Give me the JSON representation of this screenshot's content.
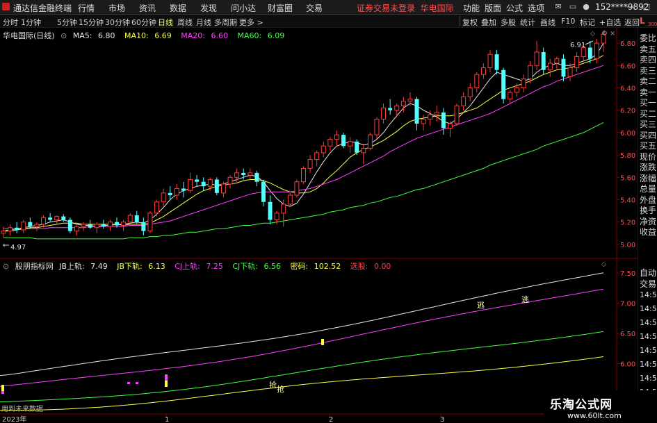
{
  "menubar": {
    "app_title": "通达信金融终端",
    "menus": [
      "行情",
      "市场",
      "资讯",
      "数据",
      "发现",
      "问小达",
      "财富圈",
      "交易"
    ],
    "notice": "证券交易未登录",
    "broker": "华电国际",
    "right_menus": [
      "功能",
      "版面",
      "公式",
      "选项"
    ],
    "account": "152****9892"
  },
  "toolbar": {
    "periods": [
      "分时",
      "1分钟",
      "5分钟",
      "15分钟",
      "30分钟",
      "60分钟",
      "日线",
      "周线",
      "月线",
      "多周期",
      "更多"
    ],
    "active_period": "日线",
    "more_arrow": ">",
    "right_tools": [
      "复权",
      "叠加",
      "多股",
      "统计",
      "画线",
      "F10",
      "标记",
      "+自选",
      "返回"
    ]
  },
  "main_chart": {
    "title": "华电国际(日线)",
    "ma": [
      {
        "label": "MA5:",
        "value": "6.80",
        "color": "#e8e8e8"
      },
      {
        "label": "MA10:",
        "value": "6.69",
        "color": "#ffff40"
      },
      {
        "label": "MA20:",
        "value": "6.60",
        "color": "#ff40ff"
      },
      {
        "label": "MA60:",
        "value": "6.09",
        "color": "#40ff40"
      }
    ],
    "y_ticks": [
      "6.80",
      "6.60",
      "6.40",
      "6.20",
      "6.00",
      "5.80",
      "5.60",
      "5.40",
      "5.20",
      "5.00"
    ],
    "low_marker": "4.97",
    "high_marker": "6.91"
  },
  "indicator": {
    "title": "股朋指标网",
    "items": [
      {
        "label": "JB上轨:",
        "value": "7.49",
        "color": "#e8e8e8"
      },
      {
        "label": "JB下轨:",
        "value": "6.13",
        "color": "#ffff40"
      },
      {
        "label": "CJ上轨:",
        "value": "7.25",
        "color": "#ff40ff"
      },
      {
        "label": "CJ下轨:",
        "value": "6.56",
        "color": "#40ff40"
      },
      {
        "label": "密码:",
        "value": "102.52",
        "color": "#ffff40"
      },
      {
        "label": "选股:",
        "value": "0.00",
        "color": "#ff4040"
      }
    ],
    "y_ticks": [
      "7.50",
      "7.00",
      "6.50",
      "6.00",
      "5.50"
    ],
    "signal_escape": "逃",
    "signal_buy": "抢",
    "footer_note": "用到未来数据"
  },
  "x_axis": {
    "labels": [
      "2023年",
      "1",
      "2",
      "3"
    ]
  },
  "side_panel": {
    "corner_label": "L",
    "corner_sub": "300",
    "quote_labels": [
      "委比",
      "卖五",
      "卖四",
      "卖三",
      "卖二",
      "卖一",
      "买一",
      "买二",
      "买三",
      "买四",
      "买五",
      "现价",
      "涨跌",
      "涨幅",
      "总量",
      "外盘",
      "换手",
      "净资",
      "收益"
    ],
    "lower_labels": [
      "自动",
      "交易"
    ],
    "times": [
      "14:56",
      "14:56",
      "14:56",
      "14:56",
      "14:56",
      "14:56",
      "14:56",
      "14:56"
    ]
  },
  "watermark": {
    "name": "乐淘公式网",
    "url": "www.60lt.com"
  },
  "chart_data": [
    {
      "type": "candlestick",
      "title": "华电国际(日线)",
      "y_range": [
        4.9,
        6.9
      ],
      "ohlc": [
        [
          5.1,
          5.16,
          5.06,
          5.12
        ],
        [
          5.12,
          5.18,
          5.08,
          5.15
        ],
        [
          5.15,
          5.2,
          5.1,
          5.13
        ],
        [
          5.13,
          5.22,
          5.1,
          5.2
        ],
        [
          5.2,
          5.24,
          5.14,
          5.16
        ],
        [
          5.16,
          5.2,
          5.12,
          5.18
        ],
        [
          5.18,
          5.26,
          5.15,
          5.24
        ],
        [
          5.24,
          5.28,
          5.2,
          5.22
        ],
        [
          5.22,
          5.26,
          5.18,
          5.25
        ],
        [
          5.25,
          5.27,
          5.2,
          5.22
        ],
        [
          5.22,
          5.24,
          5.1,
          5.12
        ],
        [
          5.12,
          5.18,
          5.08,
          5.16
        ],
        [
          5.16,
          5.2,
          5.12,
          5.18
        ],
        [
          5.18,
          5.22,
          5.14,
          5.15
        ],
        [
          5.15,
          5.2,
          5.1,
          5.18
        ],
        [
          5.18,
          5.22,
          5.14,
          5.16
        ],
        [
          5.16,
          5.22,
          5.12,
          5.2
        ],
        [
          5.2,
          5.24,
          5.15,
          5.17
        ],
        [
          5.17,
          5.22,
          5.12,
          5.2
        ],
        [
          5.2,
          5.28,
          5.16,
          5.26
        ],
        [
          5.26,
          5.3,
          5.18,
          5.2
        ],
        [
          5.2,
          5.24,
          5.08,
          5.12
        ],
        [
          5.12,
          5.3,
          5.1,
          5.28
        ],
        [
          5.28,
          5.4,
          5.25,
          5.38
        ],
        [
          5.38,
          5.5,
          5.34,
          5.46
        ],
        [
          5.46,
          5.52,
          5.4,
          5.44
        ],
        [
          5.44,
          5.54,
          5.4,
          5.5
        ],
        [
          5.5,
          5.56,
          5.42,
          5.48
        ],
        [
          5.48,
          5.64,
          5.46,
          5.58
        ],
        [
          5.58,
          5.62,
          5.52,
          5.56
        ],
        [
          5.56,
          5.6,
          5.48,
          5.52
        ],
        [
          5.52,
          5.6,
          5.48,
          5.58
        ],
        [
          5.58,
          5.6,
          5.44,
          5.46
        ],
        [
          5.46,
          5.56,
          5.42,
          5.54
        ],
        [
          5.54,
          5.62,
          5.5,
          5.6
        ],
        [
          5.6,
          5.68,
          5.56,
          5.64
        ],
        [
          5.64,
          5.68,
          5.58,
          5.62
        ],
        [
          5.62,
          5.68,
          5.58,
          5.64
        ],
        [
          5.64,
          5.66,
          5.52,
          5.56
        ],
        [
          5.56,
          5.58,
          5.34,
          5.38
        ],
        [
          5.38,
          5.44,
          5.18,
          5.22
        ],
        [
          5.22,
          5.3,
          5.18,
          5.28
        ],
        [
          5.28,
          5.4,
          5.16,
          5.36
        ],
        [
          5.36,
          5.46,
          5.34,
          5.44
        ],
        [
          5.44,
          5.58,
          5.42,
          5.56
        ],
        [
          5.56,
          5.7,
          5.54,
          5.68
        ],
        [
          5.68,
          5.8,
          5.64,
          5.76
        ],
        [
          5.76,
          5.84,
          5.7,
          5.82
        ],
        [
          5.82,
          5.92,
          5.78,
          5.88
        ],
        [
          5.88,
          5.96,
          5.84,
          5.94
        ],
        [
          5.94,
          6.02,
          5.88,
          5.98
        ],
        [
          5.98,
          6.0,
          5.86,
          5.88
        ],
        [
          5.88,
          5.96,
          5.82,
          5.92
        ],
        [
          5.92,
          5.94,
          5.8,
          5.82
        ],
        [
          5.82,
          5.9,
          5.72,
          5.86
        ],
        [
          5.86,
          6.0,
          5.84,
          5.98
        ],
        [
          5.98,
          6.14,
          5.94,
          6.12
        ],
        [
          6.12,
          6.26,
          6.08,
          6.22
        ],
        [
          6.22,
          6.3,
          6.16,
          6.2
        ],
        [
          6.2,
          6.26,
          6.14,
          6.24
        ],
        [
          6.24,
          6.32,
          6.18,
          6.28
        ],
        [
          6.28,
          6.36,
          6.24,
          6.3
        ],
        [
          6.3,
          6.32,
          6.02,
          6.08
        ],
        [
          6.08,
          6.16,
          6.02,
          6.12
        ],
        [
          6.12,
          6.2,
          6.06,
          6.16
        ],
        [
          6.16,
          6.24,
          6.1,
          6.18
        ],
        [
          6.18,
          6.22,
          5.98,
          6.04
        ],
        [
          6.04,
          6.1,
          5.96,
          6.08
        ],
        [
          6.08,
          6.26,
          6.06,
          6.24
        ],
        [
          6.24,
          6.36,
          6.2,
          6.32
        ],
        [
          6.32,
          6.44,
          6.28,
          6.4
        ],
        [
          6.4,
          6.54,
          6.36,
          6.52
        ],
        [
          6.52,
          6.62,
          6.48,
          6.58
        ],
        [
          6.58,
          6.74,
          6.54,
          6.7
        ],
        [
          6.7,
          6.74,
          6.52,
          6.56
        ],
        [
          6.56,
          6.58,
          6.26,
          6.3
        ],
        [
          6.3,
          6.38,
          6.26,
          6.36
        ],
        [
          6.36,
          6.44,
          6.32,
          6.4
        ],
        [
          6.4,
          6.52,
          6.36,
          6.48
        ],
        [
          6.48,
          6.64,
          6.44,
          6.6
        ],
        [
          6.6,
          6.82,
          6.56,
          6.72
        ],
        [
          6.72,
          6.76,
          6.52,
          6.56
        ],
        [
          6.56,
          6.66,
          6.5,
          6.62
        ],
        [
          6.62,
          6.68,
          6.56,
          6.66
        ],
        [
          6.66,
          6.7,
          6.46,
          6.5
        ],
        [
          6.5,
          6.62,
          6.46,
          6.58
        ],
        [
          6.58,
          6.72,
          6.54,
          6.68
        ],
        [
          6.68,
          6.8,
          6.64,
          6.76
        ],
        [
          6.76,
          6.82,
          6.62,
          6.66
        ],
        [
          6.66,
          6.84,
          6.62,
          6.8
        ],
        [
          6.8,
          6.91,
          6.72,
          6.88
        ]
      ],
      "series": [
        {
          "name": "MA5",
          "color": "#e8e8e8",
          "values": [
            5.12,
            5.13,
            5.14,
            5.15,
            5.16,
            5.17,
            5.18,
            5.2,
            5.21,
            5.22,
            5.2,
            5.18,
            5.17,
            5.17,
            5.16,
            5.17,
            5.17,
            5.18,
            5.18,
            5.19,
            5.2,
            5.19,
            5.22,
            5.27,
            5.33,
            5.4,
            5.45,
            5.48,
            5.5,
            5.52,
            5.53,
            5.54,
            5.53,
            5.54,
            5.56,
            5.58,
            5.6,
            5.62,
            5.61,
            5.56,
            5.48,
            5.41,
            5.36,
            5.34,
            5.37,
            5.45,
            5.55,
            5.65,
            5.74,
            5.82,
            5.88,
            5.9,
            5.92,
            5.91,
            5.89,
            5.9,
            5.94,
            6.0,
            6.08,
            6.15,
            6.22,
            6.26,
            6.24,
            6.2,
            6.17,
            6.14,
            6.1,
            6.08,
            6.12,
            6.18,
            6.24,
            6.32,
            6.4,
            6.48,
            6.54,
            6.52,
            6.5,
            6.48,
            6.46,
            6.48,
            6.54,
            6.58,
            6.6,
            6.62,
            6.6,
            6.6,
            6.62,
            6.64,
            6.66,
            6.7,
            6.8
          ]
        },
        {
          "name": "MA10",
          "color": "#ffff40",
          "values": [
            5.12,
            5.12,
            5.13,
            5.14,
            5.15,
            5.15,
            5.16,
            5.17,
            5.18,
            5.19,
            5.19,
            5.19,
            5.18,
            5.18,
            5.18,
            5.18,
            5.18,
            5.18,
            5.17,
            5.18,
            5.18,
            5.18,
            5.19,
            5.22,
            5.25,
            5.29,
            5.33,
            5.37,
            5.41,
            5.45,
            5.48,
            5.5,
            5.52,
            5.53,
            5.54,
            5.55,
            5.57,
            5.58,
            5.58,
            5.57,
            5.55,
            5.52,
            5.49,
            5.47,
            5.46,
            5.46,
            5.47,
            5.5,
            5.55,
            5.61,
            5.66,
            5.72,
            5.78,
            5.82,
            5.85,
            5.87,
            5.9,
            5.93,
            5.97,
            6.01,
            6.06,
            6.1,
            6.12,
            6.13,
            6.14,
            6.15,
            6.15,
            6.15,
            6.16,
            6.18,
            6.2,
            6.22,
            6.26,
            6.3,
            6.34,
            6.38,
            6.4,
            6.42,
            6.44,
            6.46,
            6.49,
            6.52,
            6.54,
            6.56,
            6.57,
            6.58,
            6.6,
            6.62,
            6.64,
            6.66,
            6.69
          ]
        },
        {
          "name": "MA20",
          "color": "#ff40ff",
          "values": [
            5.14,
            5.14,
            5.14,
            5.14,
            5.14,
            5.14,
            5.14,
            5.15,
            5.15,
            5.15,
            5.15,
            5.15,
            5.15,
            5.16,
            5.16,
            5.16,
            5.16,
            5.16,
            5.16,
            5.17,
            5.17,
            5.17,
            5.18,
            5.19,
            5.2,
            5.21,
            5.23,
            5.25,
            5.27,
            5.29,
            5.31,
            5.33,
            5.35,
            5.37,
            5.39,
            5.41,
            5.43,
            5.45,
            5.46,
            5.47,
            5.47,
            5.47,
            5.47,
            5.47,
            5.48,
            5.49,
            5.5,
            5.52,
            5.54,
            5.56,
            5.58,
            5.61,
            5.64,
            5.67,
            5.7,
            5.73,
            5.76,
            5.79,
            5.83,
            5.86,
            5.89,
            5.92,
            5.95,
            5.97,
            5.99,
            6.01,
            6.03,
            6.05,
            6.07,
            6.09,
            6.11,
            6.13,
            6.15,
            6.17,
            6.2,
            6.23,
            6.26,
            6.29,
            6.32,
            6.35,
            6.38,
            6.41,
            6.43,
            6.46,
            6.48,
            6.5,
            6.52,
            6.54,
            6.56,
            6.58,
            6.6
          ]
        },
        {
          "name": "MA60",
          "color": "#40ff40",
          "values": [
            5.06,
            5.06,
            5.06,
            5.06,
            5.06,
            5.05,
            5.05,
            5.05,
            5.05,
            5.05,
            5.05,
            5.05,
            5.05,
            5.05,
            5.05,
            5.05,
            5.05,
            5.05,
            5.05,
            5.06,
            5.06,
            5.06,
            5.07,
            5.07,
            5.08,
            5.08,
            5.09,
            5.1,
            5.11,
            5.11,
            5.12,
            5.13,
            5.14,
            5.14,
            5.15,
            5.16,
            5.17,
            5.17,
            5.18,
            5.19,
            5.19,
            5.2,
            5.21,
            5.22,
            5.23,
            5.24,
            5.25,
            5.26,
            5.27,
            5.29,
            5.3,
            5.31,
            5.33,
            5.34,
            5.35,
            5.37,
            5.38,
            5.4,
            5.42,
            5.43,
            5.45,
            5.47,
            5.49,
            5.5,
            5.52,
            5.54,
            5.56,
            5.58,
            5.6,
            5.62,
            5.64,
            5.66,
            5.68,
            5.71,
            5.73,
            5.75,
            5.77,
            5.79,
            5.81,
            5.83,
            5.85,
            5.88,
            5.9,
            5.92,
            5.94,
            5.96,
            5.98,
            6.0,
            6.03,
            6.06,
            6.09
          ]
        }
      ]
    },
    {
      "type": "line",
      "title": "股朋指标网",
      "y_range": [
        5.2,
        7.65
      ],
      "series": [
        {
          "name": "JB上轨",
          "color": "#e8e8e8",
          "start": 5.8,
          "end": 7.49
        },
        {
          "name": "CJ上轨",
          "color": "#ff40ff",
          "start": 5.58,
          "end": 7.25
        },
        {
          "name": "CJ下轨",
          "color": "#40ff40",
          "start": 5.32,
          "end": 6.56
        },
        {
          "name": "JB下轨",
          "color": "#ffff40",
          "start": 5.22,
          "end": 6.13
        }
      ]
    }
  ]
}
